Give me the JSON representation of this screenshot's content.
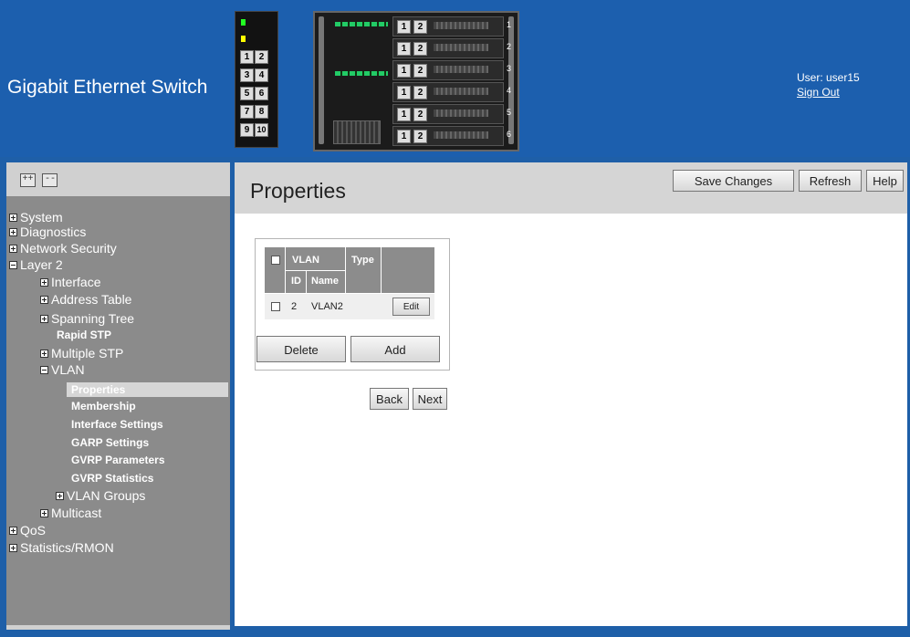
{
  "header": {
    "brand": "Gigabit Ethernet Switch",
    "user_label": "User: user15",
    "sign_out": "Sign Out",
    "small_unit_ports": [
      "1",
      "2",
      "3",
      "4",
      "5",
      "6",
      "7",
      "8",
      "9",
      "10"
    ],
    "bay_ports": [
      "1",
      "2"
    ],
    "bay_numbers": [
      "1",
      "2",
      "3",
      "4",
      "5",
      "6"
    ]
  },
  "sidebar": {
    "expand_all": "++",
    "collapse_all": "--",
    "items": [
      {
        "label": "System"
      },
      {
        "label": "Diagnostics"
      },
      {
        "label": "Network Security"
      },
      {
        "label": "Layer 2"
      },
      {
        "label": "Interface"
      },
      {
        "label": "Address Table"
      },
      {
        "label": "Spanning Tree"
      },
      {
        "label": "Rapid STP"
      },
      {
        "label": "Multiple STP"
      },
      {
        "label": "VLAN"
      },
      {
        "label": "Properties"
      },
      {
        "label": "Membership"
      },
      {
        "label": "Interface Settings"
      },
      {
        "label": "GARP Settings"
      },
      {
        "label": "GVRP Parameters"
      },
      {
        "label": "GVRP Statistics"
      },
      {
        "label": "VLAN Groups"
      },
      {
        "label": "Multicast"
      },
      {
        "label": "QoS"
      },
      {
        "label": "Statistics/RMON"
      }
    ]
  },
  "main": {
    "title": "Properties",
    "buttons": {
      "save": "Save Changes",
      "refresh": "Refresh",
      "help": "Help"
    },
    "table": {
      "headers": {
        "vlan": "VLAN",
        "type": "Type",
        "id": "ID",
        "name": "Name"
      },
      "rows": [
        {
          "id": "2",
          "name": "VLAN2",
          "action": "Edit"
        }
      ]
    },
    "delete": "Delete",
    "add": "Add",
    "back": "Back",
    "next": "Next"
  }
}
